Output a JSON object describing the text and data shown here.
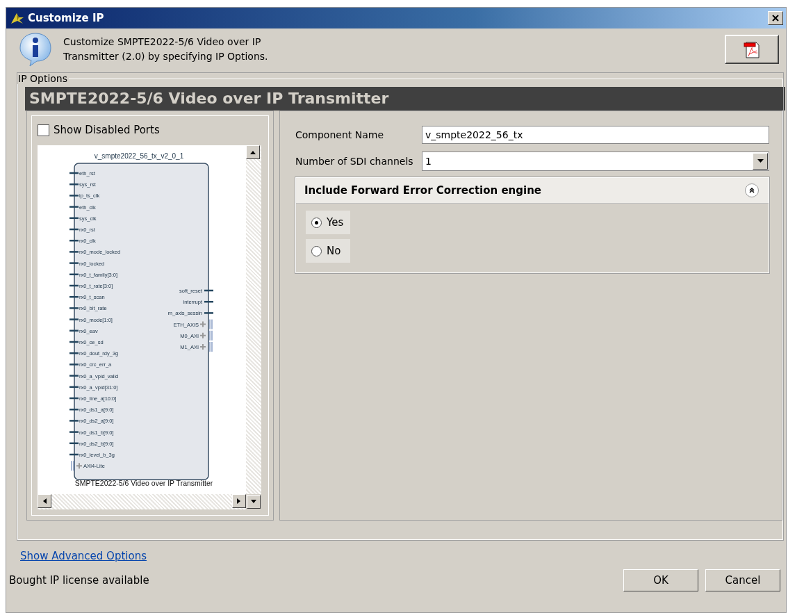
{
  "window": {
    "title": "Customize IP"
  },
  "header": {
    "description": "Customize SMPTE2022-5/6 Video over IP Transmitter (2.0) by specifying IP Options."
  },
  "ip_options": {
    "label": "IP Options",
    "banner": "SMPTE2022-5/6 Video over IP Transmitter"
  },
  "symbol": {
    "show_disabled_ports": {
      "label": "Show Disabled Ports",
      "checked": false
    },
    "instance": "v_smpte2022_56_tx_v2_0_1",
    "caption": "SMPTE2022-5/6 Video over IP Transmitter",
    "left_ports": [
      {
        "name": "eth_rst",
        "kind": "pin"
      },
      {
        "name": "sys_rst",
        "kind": "pin"
      },
      {
        "name": "ip_ts_clk",
        "kind": "pin"
      },
      {
        "name": "eth_clk",
        "kind": "pin"
      },
      {
        "name": "sys_clk",
        "kind": "pin"
      },
      {
        "name": "rx0_rst",
        "kind": "pin"
      },
      {
        "name": "rx0_clk",
        "kind": "pin"
      },
      {
        "name": "rx0_mode_locked",
        "kind": "pin"
      },
      {
        "name": "rx0_locked",
        "kind": "pin"
      },
      {
        "name": "rx0_t_family[3:0]",
        "kind": "pin"
      },
      {
        "name": "rx0_t_rate[3:0]",
        "kind": "pin"
      },
      {
        "name": "rx0_t_scan",
        "kind": "pin"
      },
      {
        "name": "rx0_bit_rate",
        "kind": "pin"
      },
      {
        "name": "rx0_mode[1:0]",
        "kind": "pin"
      },
      {
        "name": "rx0_eav",
        "kind": "pin"
      },
      {
        "name": "rx0_ce_sd",
        "kind": "pin"
      },
      {
        "name": "rx0_dout_rdy_3g",
        "kind": "pin"
      },
      {
        "name": "rx0_crc_err_a",
        "kind": "pin"
      },
      {
        "name": "rx0_a_vpid_valid",
        "kind": "pin"
      },
      {
        "name": "rx0_a_vpid[31:0]",
        "kind": "pin"
      },
      {
        "name": "rx0_line_a[10:0]",
        "kind": "pin"
      },
      {
        "name": "rx0_ds1_a[9:0]",
        "kind": "pin"
      },
      {
        "name": "rx0_ds2_a[9:0]",
        "kind": "pin"
      },
      {
        "name": "rx0_ds1_b[9:0]",
        "kind": "pin"
      },
      {
        "name": "rx0_ds2_b[9:0]",
        "kind": "pin"
      },
      {
        "name": "rx0_level_b_3g",
        "kind": "pin"
      },
      {
        "name": "AXI4-Lite",
        "kind": "bus"
      }
    ],
    "right_ports": [
      {
        "name": "soft_reset",
        "kind": "pin"
      },
      {
        "name": "interrupt",
        "kind": "pin"
      },
      {
        "name": "m_axis_sessin",
        "kind": "pin"
      },
      {
        "name": "ETH_AXIS",
        "kind": "bus"
      },
      {
        "name": "M0_AXI",
        "kind": "bus"
      },
      {
        "name": "M1_AXI",
        "kind": "bus"
      }
    ]
  },
  "form": {
    "component_name": {
      "label": "Component Name",
      "value": "v_smpte2022_56_tx"
    },
    "sdi_channels": {
      "label": "Number of SDI channels",
      "value": "1"
    },
    "fec_group": {
      "title": "Include Forward Error Correction engine",
      "expanded": true,
      "options": [
        {
          "label": "Yes",
          "selected": true
        },
        {
          "label": "No",
          "selected": false
        }
      ]
    }
  },
  "footer": {
    "advanced_link": "Show Advanced Options",
    "license": "Bought IP license available",
    "buttons": [
      "OK",
      "Cancel"
    ]
  }
}
